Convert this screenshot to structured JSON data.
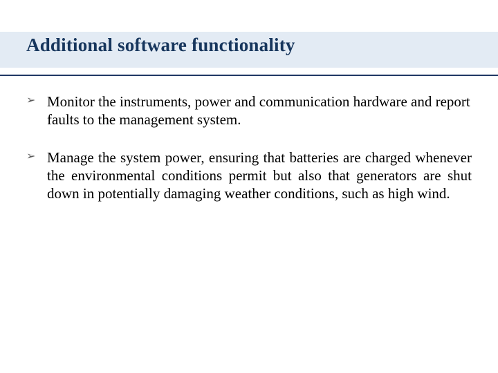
{
  "slide": {
    "title": "Additional software functionality",
    "bullets": [
      {
        "marker": "➢",
        "text": "Monitor the instruments, power and communication hardware and report faults to the management system.",
        "justify": false
      },
      {
        "marker": "➢",
        "text": "Manage the system power, ensuring that batteries are charged whenever the environmental conditions permit but also that generators are shut down in potentially damaging weather conditions, such as high wind.",
        "justify": true
      }
    ]
  }
}
